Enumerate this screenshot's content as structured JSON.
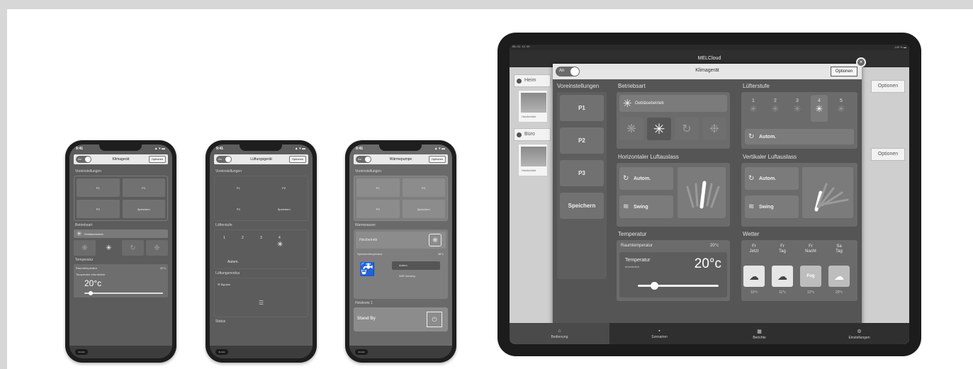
{
  "phones": [
    {
      "status_time": "9:41",
      "status_icons": "▲ ▾ ▬",
      "toggle": "An",
      "title": "Klimagerät",
      "options": "Optionen",
      "section1": "Voreinstellungen",
      "presets": [
        "P1",
        "P2",
        "P3",
        "Speichern"
      ],
      "section2": "Betriebsart",
      "mode_label": "Gebläsebetrieb",
      "section3": "Temperatur",
      "room_label": "Raumtemperatur",
      "room_value": "20°c",
      "target_label": "Temperatur erforderlich",
      "temp_value": "20°c",
      "footer": "Zurück"
    },
    {
      "status_time": "9:41",
      "status_icons": "▲ ▾ ▬",
      "toggle": "An",
      "title": "Lüftungsgerät",
      "options": "Optionen",
      "section1": "Voreinstellungen",
      "presets": [
        "P1",
        "P2",
        "P3",
        "Speichern"
      ],
      "section2": "Lüfterstufe",
      "fan_levels": [
        "1",
        "2",
        "3",
        "4"
      ],
      "fan_auto": "Autom.",
      "section3": "Lüftungsmodus",
      "mode_label": "Bypass",
      "section4": "Status",
      "footer": "Zurück"
    },
    {
      "status_time": "9:41",
      "status_icons": "▲ ▾ ▬",
      "toggle": "An",
      "title": "Wärmepumpe",
      "options": "Optionen",
      "section1": "Voreinstellungen",
      "presets": [
        "P1",
        "P2",
        "P3",
        "Speichern"
      ],
      "section2": "Warmwasser",
      "heat_label": "Heizbetrieb",
      "tank_label": "Speichertemperatur",
      "tank_value": "38°c",
      "opt_auto": "Autom.",
      "opt_boost": "WW Vorrang",
      "section3": "Heizkreis 1",
      "standby": "Stand By",
      "footer": "Zurück"
    }
  ],
  "tablet": {
    "status_left": "Mo 31. 12. 09",
    "status_right": "100 % ▬",
    "nav_title": "MELCloud",
    "bg_items": [
      "Heim",
      "Büro"
    ],
    "bg_card_text": "Heizbetrieb",
    "bg_options": "Optionen",
    "modal": {
      "toggle": "An",
      "title": "Klimagerät",
      "options": "Optionen",
      "presets_label": "Voreinstellungen",
      "presets": [
        "P1",
        "P2",
        "P3",
        "Speichern"
      ],
      "mode_label": "Betriebsart",
      "mode_value": "Gebläsebetrieb",
      "fan_label": "Lüfterstufe",
      "fan_levels": [
        "1",
        "2",
        "3",
        "4",
        "5"
      ],
      "fan_auto": "Autom.",
      "h_label": "Horizontaler Luftauslass",
      "v_label": "Vertikaler Luftauslass",
      "auto": "Autom.",
      "swing": "Swing",
      "temp_label": "Temperatur",
      "room_label": "Raumtemperatur",
      "room_value": "20°c",
      "target_label": "Temperatur",
      "target_sub": "erforderlich",
      "temp_value": "20°c",
      "weather_label": "Wetter",
      "weather": [
        {
          "day": "Fr",
          "part": "Jetzt",
          "temp": "10°c"
        },
        {
          "day": "Fr",
          "part": "Tag",
          "temp": "11°c"
        },
        {
          "day": "Fr",
          "part": "Nacht",
          "temp": "12°c",
          "badge": "Fog"
        },
        {
          "day": "Sa",
          "part": "Tag",
          "temp": "20°c"
        }
      ]
    },
    "tabs": [
      "Bedienung",
      "Szenarien",
      "Berichte",
      "Einstellungen"
    ]
  }
}
